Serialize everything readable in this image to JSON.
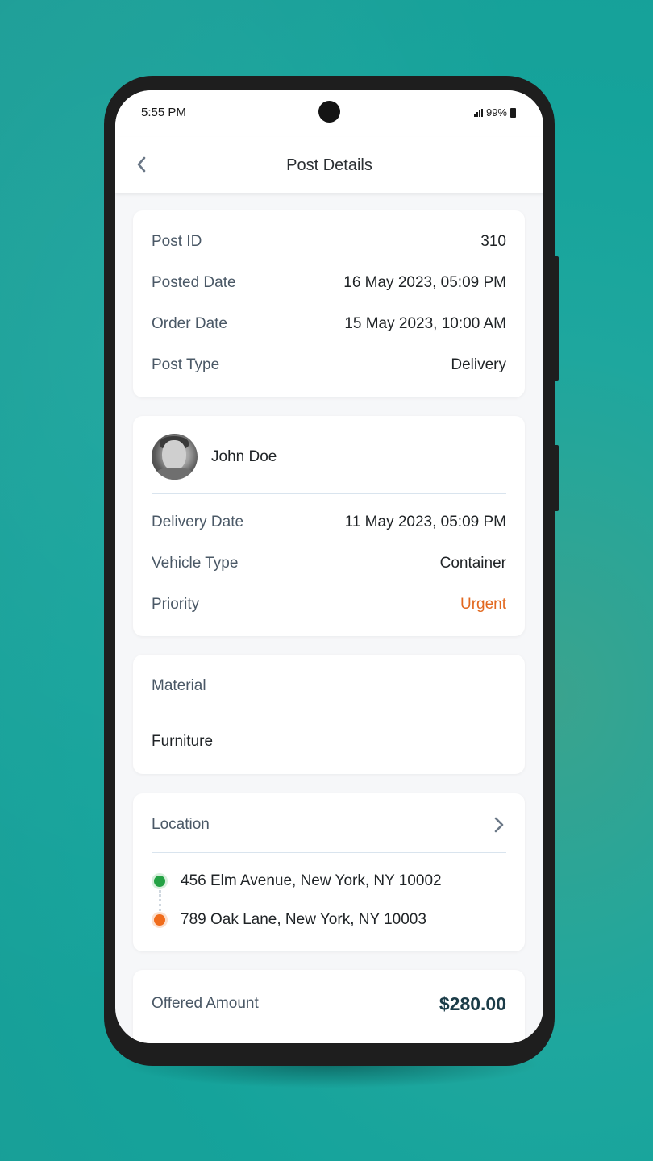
{
  "status_bar": {
    "time": "5:55 PM",
    "battery_text": "99%"
  },
  "app_bar": {
    "title": "Post Details",
    "back_icon": "chevron-left-icon"
  },
  "post_info": {
    "rows": [
      {
        "label": "Post ID",
        "value": "310"
      },
      {
        "label": "Posted Date",
        "value": "16 May 2023, 05:09 PM"
      },
      {
        "label": "Order Date",
        "value": "15 May 2023, 10:00 AM"
      },
      {
        "label": "Post Type",
        "value": "Delivery"
      }
    ]
  },
  "delivery_info": {
    "user_name": "John Doe",
    "rows": [
      {
        "label": "Delivery Date",
        "value": "11 May 2023, 05:09 PM"
      },
      {
        "label": "Vehicle Type",
        "value": "Container"
      },
      {
        "label": "Priority",
        "value": "Urgent"
      }
    ]
  },
  "material": {
    "title": "Material",
    "value": "Furniture"
  },
  "location": {
    "title": "Location",
    "pickup": "456 Elm Avenue, New York, NY 10002",
    "dropoff": "789 Oak Lane, New York, NY 10003"
  },
  "offer": {
    "label": "Offered Amount",
    "amount": "$280.00"
  },
  "colors": {
    "urgent": "#e2681f",
    "pickup_dot": "#23a244",
    "dropoff_dot": "#f06c1c",
    "amount": "#1b3c48",
    "background": "#15a39b"
  }
}
